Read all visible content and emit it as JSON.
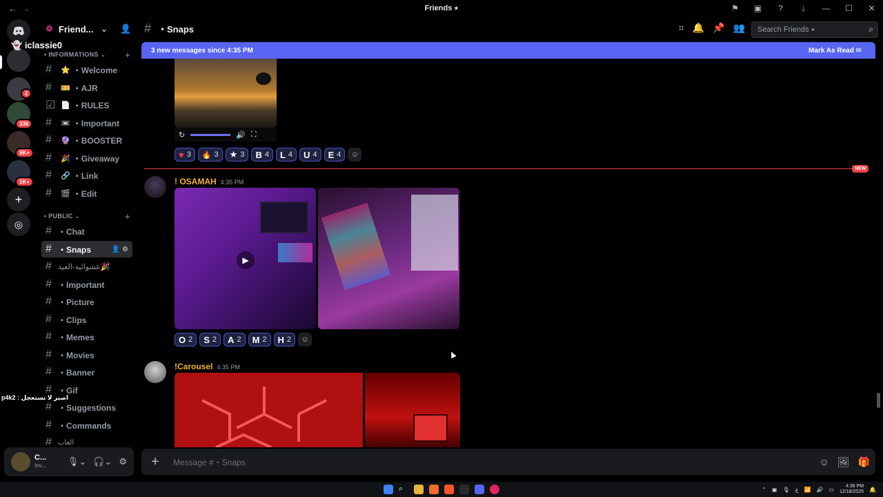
{
  "window": {
    "title": "Friends ⭑",
    "back_glyph": "←",
    "forward_glyph": "→"
  },
  "rail": {
    "badges": [
      "2",
      "336",
      "9K+",
      "1K+"
    ]
  },
  "guild": {
    "name": "Friend...",
    "snapchat_user": "iclassie0"
  },
  "categories": {
    "informations": "• INFORMATIONS ⌄",
    "public": "• PUBLIC ⌄"
  },
  "channels_info": [
    {
      "label": "・Welcome",
      "emoji": "⭐"
    },
    {
      "label": "・AJR",
      "emoji": "🎫"
    },
    {
      "label": "・RULES",
      "emoji": "📄"
    },
    {
      "label": "・Important",
      "emoji": "📼"
    },
    {
      "label": "・BOOSTER",
      "emoji": "🔮"
    },
    {
      "label": "・Giveaway",
      "emoji": "🎉"
    },
    {
      "label": "・Link",
      "emoji": "🔗"
    },
    {
      "label": "・Edit",
      "emoji": "🎬"
    }
  ],
  "channels_public": [
    {
      "label": "・Chat"
    },
    {
      "label": "・Snaps"
    },
    {
      "label": "عشوائية-العيد🎉"
    },
    {
      "label": "・Important"
    },
    {
      "label": "・Picture"
    },
    {
      "label": "・Clips"
    },
    {
      "label": "・Memes"
    },
    {
      "label": "・Movies"
    },
    {
      "label": "・Banner"
    },
    {
      "label": "・Gif"
    },
    {
      "label": "・Suggestions"
    },
    {
      "label": "・Commands"
    },
    {
      "label": "العاب"
    }
  ],
  "overlay": {
    "p4k2_text": "p4k2 : اصبر لا تستعجل"
  },
  "user_panel": {
    "name": "C...",
    "status": "Inv..."
  },
  "header": {
    "channel_name": "・Snaps",
    "search_placeholder": "Search Friends ⭑"
  },
  "new_messages": {
    "text": "3 new messages since 4:35 PM",
    "mark_read": "Mark As Read"
  },
  "divider": {
    "label": "NEW"
  },
  "reactions_top": [
    {
      "emoji": "♥",
      "count": "3",
      "color": "#f23f43"
    },
    {
      "emoji": "🔥",
      "count": "3",
      "color": "#f57c00"
    },
    {
      "emoji": "★",
      "count": "3",
      "color": "#ffffff"
    },
    {
      "emoji": "B",
      "count": "4",
      "color": "#ffffff"
    },
    {
      "emoji": "L",
      "count": "4",
      "color": "#ffffff"
    },
    {
      "emoji": "U",
      "count": "4",
      "color": "#ffffff"
    },
    {
      "emoji": "E",
      "count": "4",
      "color": "#ffffff"
    }
  ],
  "messages": [
    {
      "author": "! OSAMAH",
      "time": "4:35 PM",
      "reactions": [
        {
          "emoji": "O",
          "count": "2"
        },
        {
          "emoji": "S",
          "count": "2"
        },
        {
          "emoji": "A",
          "count": "2"
        },
        {
          "emoji": "M",
          "count": "2"
        },
        {
          "emoji": "H",
          "count": "2"
        }
      ]
    },
    {
      "author": "!Carousel",
      "time": "4:35 PM"
    }
  ],
  "composer": {
    "placeholder": "Message #・Snaps"
  },
  "taskbar": {
    "time": "4:38 PM",
    "date": "12/18/2025"
  }
}
